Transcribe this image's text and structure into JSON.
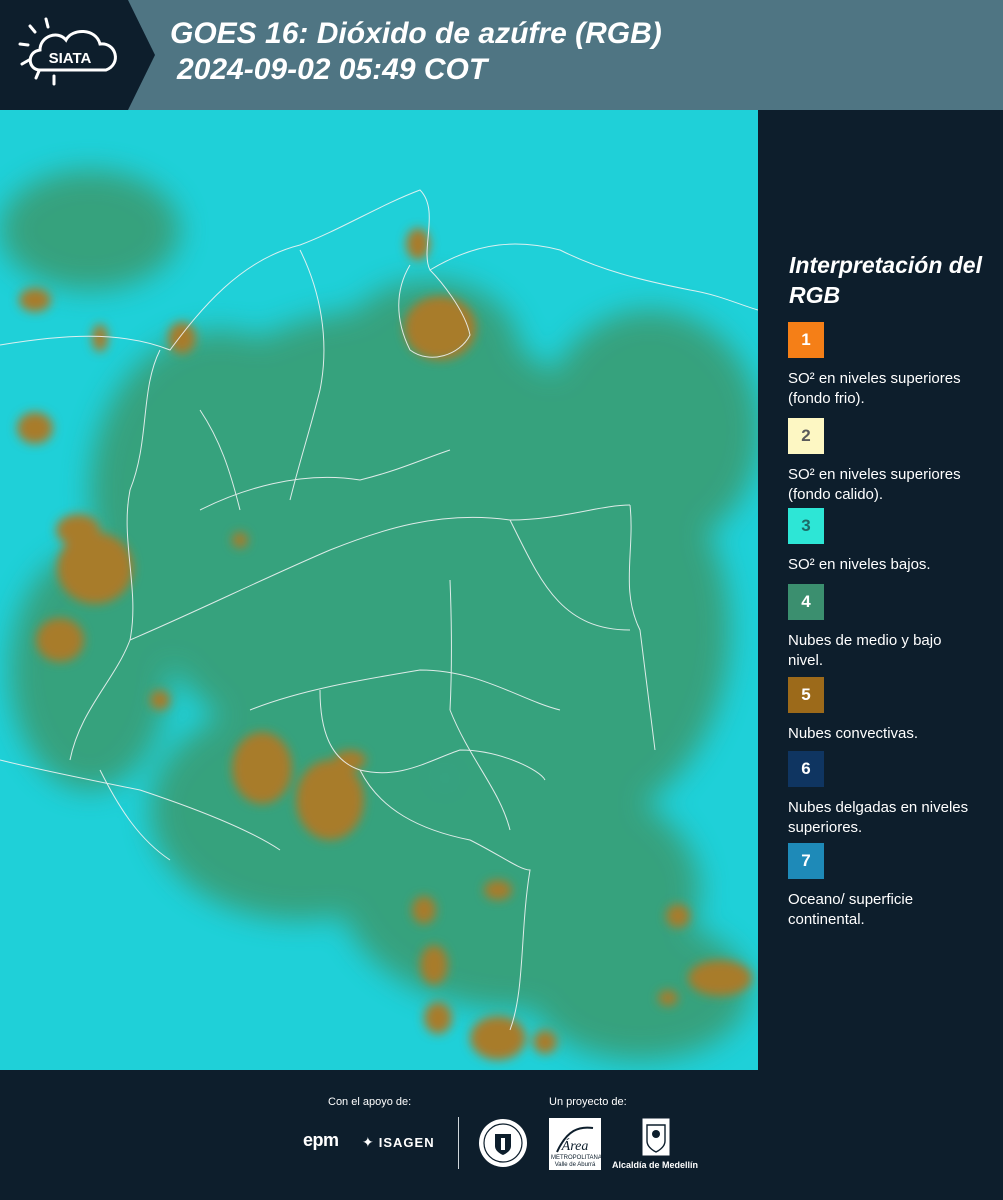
{
  "header": {
    "brand": "SIATA",
    "title_line1": "GOES 16: Dióxido de azúfre (RGB)",
    "title_line2": "2024-09-02 05:49 COT"
  },
  "colors": {
    "header_bg": "#4f7583",
    "panel_bg": "#0d1e2c",
    "map_background": "#1fd0d8",
    "mid_low_cloud": "#3a9a6e",
    "convective_cloud": "#a87b2c"
  },
  "legend": {
    "title": "Interpretación del RGB",
    "items": [
      {
        "number": "1",
        "color": "#f57f17",
        "text_color": "#ffffff",
        "label": "SO² en niveles superiores (fondo frio)."
      },
      {
        "number": "2",
        "color": "#fdf7c3",
        "text_color": "#5a5a5a",
        "label": "SO² en niveles superiores (fondo calido)."
      },
      {
        "number": "3",
        "color": "#2de6d6",
        "text_color": "#1d6b66",
        "label": "SO² en niveles bajos."
      },
      {
        "number": "4",
        "color": "#3b8f6f",
        "text_color": "#ffffff",
        "label": "Nubes de medio y bajo nivel."
      },
      {
        "number": "5",
        "color": "#9c6a1a",
        "text_color": "#ffffff",
        "label": "Nubes convectivas."
      },
      {
        "number": "6",
        "color": "#0f3561",
        "text_color": "#ffffff",
        "label": "Nubes delgadas en niveles superiores."
      },
      {
        "number": "7",
        "color": "#1e8ab8",
        "text_color": "#ffffff",
        "label": "Oceano/ superficie continental."
      }
    ]
  },
  "footer": {
    "support_label": "Con el apoyo de:",
    "project_label": "Un proyecto de:",
    "sponsor_epm": "epm",
    "sponsor_isagen": "ISAGEN",
    "area_name": "Área",
    "area_caption": "METROPOLITANA Valle de Aburrá",
    "alcaldia": "Alcaldía de Medellín"
  }
}
